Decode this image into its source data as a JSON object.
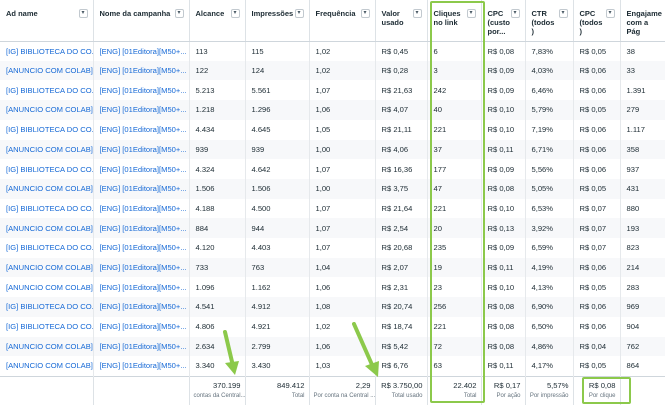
{
  "columns": [
    {
      "label": "Ad name",
      "menu": true
    },
    {
      "label": "Nome da campanha",
      "menu": true
    },
    {
      "label": "Alcance",
      "menu": true
    },
    {
      "label": "Impressões",
      "menu": true
    },
    {
      "label": "Frequência",
      "menu": true
    },
    {
      "label": "Valor usado",
      "menu": true
    },
    {
      "label": "Cliques no link",
      "menu": true
    },
    {
      "label": "CPC (custo por...",
      "menu": true
    },
    {
      "label": "CTR (todos )",
      "menu": true
    },
    {
      "label": "CPC (todos )",
      "menu": true
    },
    {
      "label": "Engajame com a Pág",
      "menu": false
    }
  ],
  "rows": [
    [
      "[IG] BIBLIOTECA DO CO...",
      "[ENG] [01Editora][M50+...",
      "113",
      "115",
      "1,02",
      "R$ 0,45",
      "6",
      "R$ 0,08",
      "7,83%",
      "R$ 0,05",
      "38"
    ],
    [
      "[ANUNCIO COM COLAB]",
      "[ENG] [01Editora][M50+...",
      "122",
      "124",
      "1,02",
      "R$ 0,28",
      "3",
      "R$ 0,09",
      "4,03%",
      "R$ 0,06",
      "33"
    ],
    [
      "[IG] BIBLIOTECA DO CO...",
      "[ENG] [01Editora][M50+...",
      "5.213",
      "5.561",
      "1,07",
      "R$ 21,63",
      "242",
      "R$ 0,09",
      "6,46%",
      "R$ 0,06",
      "1.391"
    ],
    [
      "[ANUNCIO COM COLAB]",
      "[ENG] [01Editora][M50+...",
      "1.218",
      "1.296",
      "1,06",
      "R$ 4,07",
      "40",
      "R$ 0,10",
      "5,79%",
      "R$ 0,05",
      "279"
    ],
    [
      "[IG] BIBLIOTECA DO CO...",
      "[ENG] [01Editora][M50+...",
      "4.434",
      "4.645",
      "1,05",
      "R$ 21,11",
      "221",
      "R$ 0,10",
      "7,19%",
      "R$ 0,06",
      "1.117"
    ],
    [
      "[ANUNCIO COM COLAB]",
      "[ENG] [01Editora][M50+...",
      "939",
      "939",
      "1,00",
      "R$ 4,06",
      "37",
      "R$ 0,11",
      "6,71%",
      "R$ 0,06",
      "358"
    ],
    [
      "[IG] BIBLIOTECA DO CO...",
      "[ENG] [01Editora][M50+...",
      "4.324",
      "4.642",
      "1,07",
      "R$ 16,36",
      "177",
      "R$ 0,09",
      "5,56%",
      "R$ 0,06",
      "937"
    ],
    [
      "[ANUNCIO COM COLAB]",
      "[ENG] [01Editora][M50+...",
      "1.506",
      "1.506",
      "1,00",
      "R$ 3,75",
      "47",
      "R$ 0,08",
      "5,05%",
      "R$ 0,05",
      "431"
    ],
    [
      "[IG] BIBLIOTECA DO CO...",
      "[ENG] [01Editora][M50+...",
      "4.188",
      "4.500",
      "1,07",
      "R$ 21,64",
      "221",
      "R$ 0,10",
      "6,53%",
      "R$ 0,07",
      "880"
    ],
    [
      "[ANUNCIO COM COLAB]",
      "[ENG] [01Editora][M50+...",
      "884",
      "944",
      "1,07",
      "R$ 2,54",
      "20",
      "R$ 0,13",
      "3,92%",
      "R$ 0,07",
      "193"
    ],
    [
      "[IG] BIBLIOTECA DO CO...",
      "[ENG] [01Editora][M50+...",
      "4.120",
      "4.403",
      "1,07",
      "R$ 20,68",
      "235",
      "R$ 0,09",
      "6,59%",
      "R$ 0,07",
      "823"
    ],
    [
      "[ANUNCIO COM COLAB]",
      "[ENG] [01Editora][M50+...",
      "733",
      "763",
      "1,04",
      "R$ 2,07",
      "19",
      "R$ 0,11",
      "4,19%",
      "R$ 0,06",
      "214"
    ],
    [
      "[ANUNCIO COM COLAB]",
      "[ENG] [01Editora][M50+...",
      "1.096",
      "1.162",
      "1,06",
      "R$ 2,31",
      "23",
      "R$ 0,10",
      "4,13%",
      "R$ 0,05",
      "283"
    ],
    [
      "[IG] BIBLIOTECA DO CO...",
      "[ENG] [01Editora][M50+...",
      "4.541",
      "4.912",
      "1,08",
      "R$ 20,74",
      "256",
      "R$ 0,08",
      "6,90%",
      "R$ 0,06",
      "969"
    ],
    [
      "[IG] BIBLIOTECA DO CO...",
      "[ENG] [01Editora][M50+...",
      "4.806",
      "4.921",
      "1,02",
      "R$ 18,74",
      "221",
      "R$ 0,08",
      "6,50%",
      "R$ 0,06",
      "904"
    ],
    [
      "[ANUNCIO COM COLAB]",
      "[ENG] [01Editora][M50+...",
      "2.634",
      "2.799",
      "1,06",
      "R$ 5,42",
      "72",
      "R$ 0,08",
      "4,86%",
      "R$ 0,04",
      "762"
    ],
    [
      "[ANUNCIO COM COLAB]",
      "[ENG] [01Editora][M50+...",
      "3.340",
      "3.430",
      "1,03",
      "R$ 6,76",
      "63",
      "R$ 0,11",
      "4,17%",
      "R$ 0,05",
      "864"
    ]
  ],
  "totals": [
    {
      "value": "",
      "sub": ""
    },
    {
      "value": "",
      "sub": ""
    },
    {
      "value": "370.199",
      "sub": "contas da Central..."
    },
    {
      "value": "849.412",
      "sub": "Total"
    },
    {
      "value": "2,29",
      "sub": "Por conta na Central ..."
    },
    {
      "value": "R$ 3.750,00",
      "sub": "Total usado"
    },
    {
      "value": "22.402",
      "sub": "Total"
    },
    {
      "value": "R$ 0,17",
      "sub": "Por ação"
    },
    {
      "value": "5,57%",
      "sub": "Por impressão"
    },
    {
      "value": "R$ 0,08",
      "sub": "Por clique"
    },
    {
      "value": "",
      "sub": ""
    }
  ],
  "menu_glyph": "▾",
  "highlight_color": "#8cc94b",
  "link_color": "#1669d6"
}
